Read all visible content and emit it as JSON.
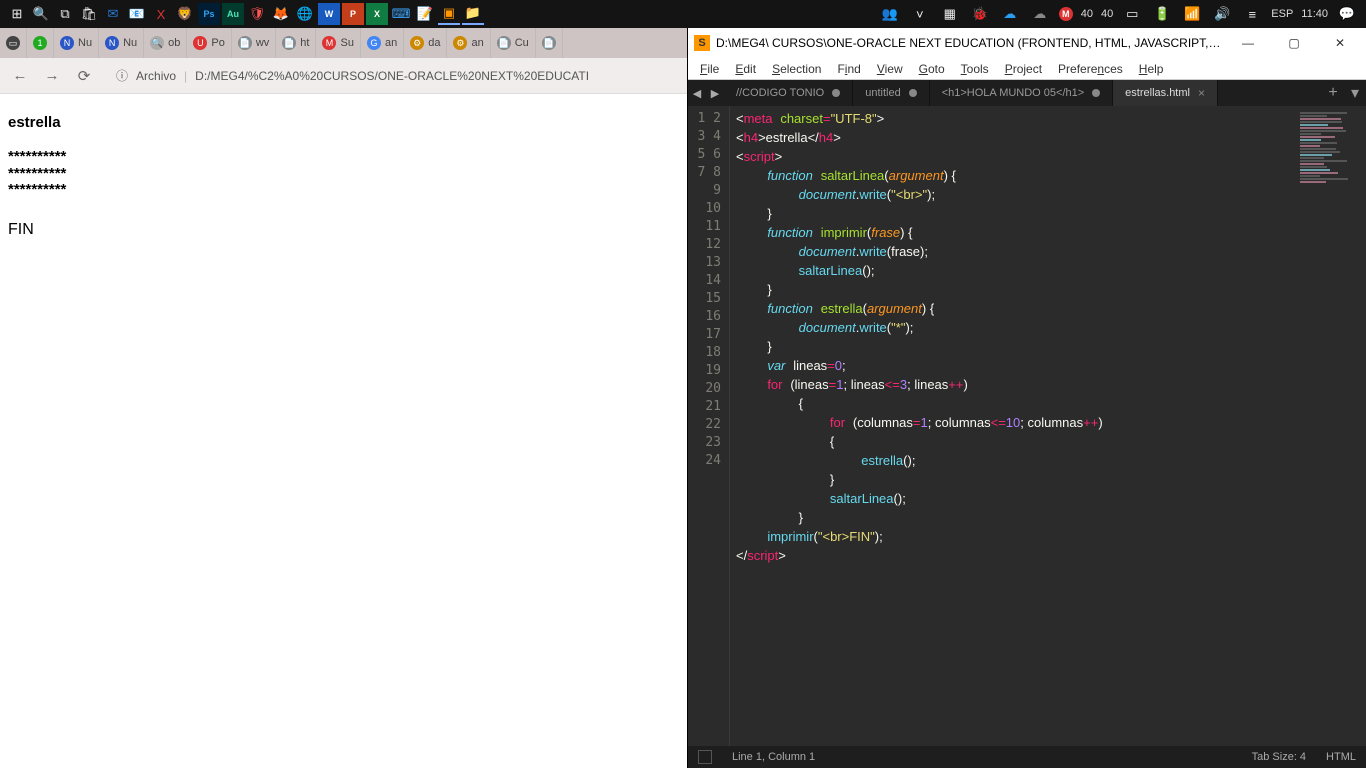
{
  "taskbar": {
    "temps": [
      "40",
      "40"
    ],
    "lang": "ESP",
    "clock": "11:40"
  },
  "browser": {
    "tabs": [
      {
        "ico": "",
        "label": ""
      },
      {
        "ico": "⬤",
        "label": ""
      },
      {
        "ico": "N",
        "label": "Nu"
      },
      {
        "ico": "N",
        "label": "Nu"
      },
      {
        "ico": "🔍",
        "label": "ob"
      },
      {
        "ico": "U",
        "label": "Po"
      },
      {
        "ico": "",
        "label": "wv"
      },
      {
        "ico": "",
        "label": "ht"
      },
      {
        "ico": "M",
        "label": "Su"
      },
      {
        "ico": "G",
        "label": "an"
      },
      {
        "ico": "",
        "label": "da"
      },
      {
        "ico": "",
        "label": "an"
      },
      {
        "ico": "",
        "label": "Cu"
      },
      {
        "ico": "",
        "label": ""
      }
    ],
    "addr_label": "Archivo",
    "addr_path": "D:/MEG4/%C2%A0%20CURSOS/ONE-ORACLE%20NEXT%20EDUCATI"
  },
  "page": {
    "title": "estrella",
    "stars_per_row": 10,
    "rows": 3,
    "fin": "FIN"
  },
  "sublime": {
    "title": "D:\\MEG4\\  CURSOS\\ONE-ORACLE NEXT EDUCATION (FRONTEND, HTML, JAVASCRIPT, CSS, JA...",
    "menus": [
      "File",
      "Edit",
      "Selection",
      "Find",
      "View",
      "Goto",
      "Tools",
      "Project",
      "Preferences",
      "Help"
    ],
    "tabs": [
      {
        "label": "//CODIGO TONIO",
        "dirty": true,
        "active": false
      },
      {
        "label": "untitled",
        "dirty": true,
        "active": false
      },
      {
        "label": "<h1>HOLA MUNDO 05</h1>",
        "dirty": true,
        "active": false
      },
      {
        "label": "estrellas.html",
        "dirty": false,
        "active": true
      }
    ],
    "status_left": "Line 1, Column 1",
    "status_tab": "Tab Size: 4",
    "status_lang": "HTML",
    "line_count": 24
  },
  "code": {
    "l1": {
      "a": "meta",
      "b": "charset",
      "c": "\"UTF-8\""
    },
    "l2": {
      "a": "h4",
      "b": "estrella"
    },
    "l3": {
      "a": "script"
    },
    "l4": {
      "kw": "function",
      "name": "saltarLinea",
      "arg": "argument"
    },
    "l5": {
      "obj": "document",
      "fn": "write",
      "str": "\"<br>\""
    },
    "l7": {
      "kw": "function",
      "name": "imprimir",
      "arg": "frase"
    },
    "l8": {
      "obj": "document",
      "fn": "write",
      "arg": "frase"
    },
    "l9": {
      "call": "saltarLinea"
    },
    "l11": {
      "kw": "function",
      "name": "estrella",
      "arg": "argument"
    },
    "l12": {
      "obj": "document",
      "fn": "write",
      "str": "\"*\""
    },
    "l14": {
      "kw": "var",
      "v": "lineas",
      "n": "0"
    },
    "l15": {
      "kw": "for",
      "v": "lineas",
      "n1": "1",
      "n2": "3"
    },
    "l17": {
      "kw": "for",
      "v": "columnas",
      "n1": "1",
      "n2": "10"
    },
    "l19": {
      "call": "estrella"
    },
    "l21": {
      "call": "saltarLinea"
    },
    "l23": {
      "call": "imprimir",
      "str": "\"<br>FIN\""
    },
    "l24": {
      "a": "script"
    }
  }
}
